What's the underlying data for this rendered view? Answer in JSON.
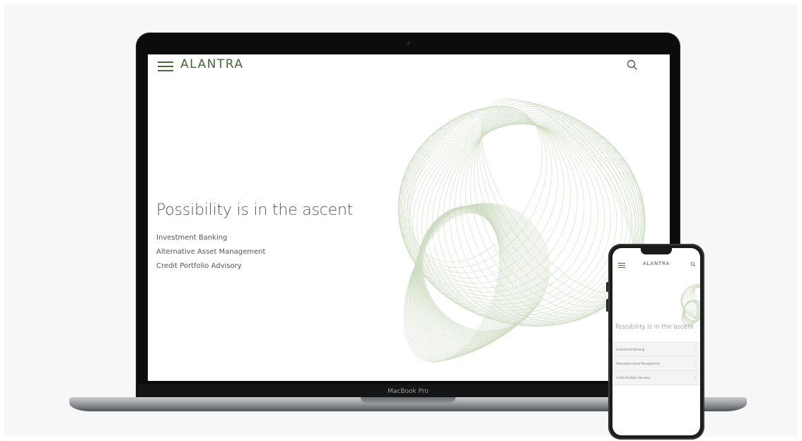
{
  "laptop": {
    "brand_label": "MacBook Pro",
    "site": {
      "logo": "ALANTRA",
      "headline": "Possibility is in the ascent",
      "nav_links": [
        "Investment Banking",
        "Alternative Asset Management",
        "Credit Portfolio Advisory"
      ],
      "icons": [
        "hamburger-menu-icon",
        "search-icon"
      ]
    }
  },
  "phone": {
    "site": {
      "logo": "ALANTRA",
      "headline": "Possibility is in the ascent",
      "nav_links": [
        "Investment Banking",
        "Alternative Asset Management",
        "Credit Portfolio Advisory"
      ],
      "icons": [
        "hamburger-menu-icon",
        "search-icon",
        "chevron-right-icon"
      ]
    }
  },
  "colors": {
    "brand_green": "#44673a",
    "art_line": "#cfdcc4",
    "text_gray": "#555555",
    "background": "#f7f7f7"
  }
}
